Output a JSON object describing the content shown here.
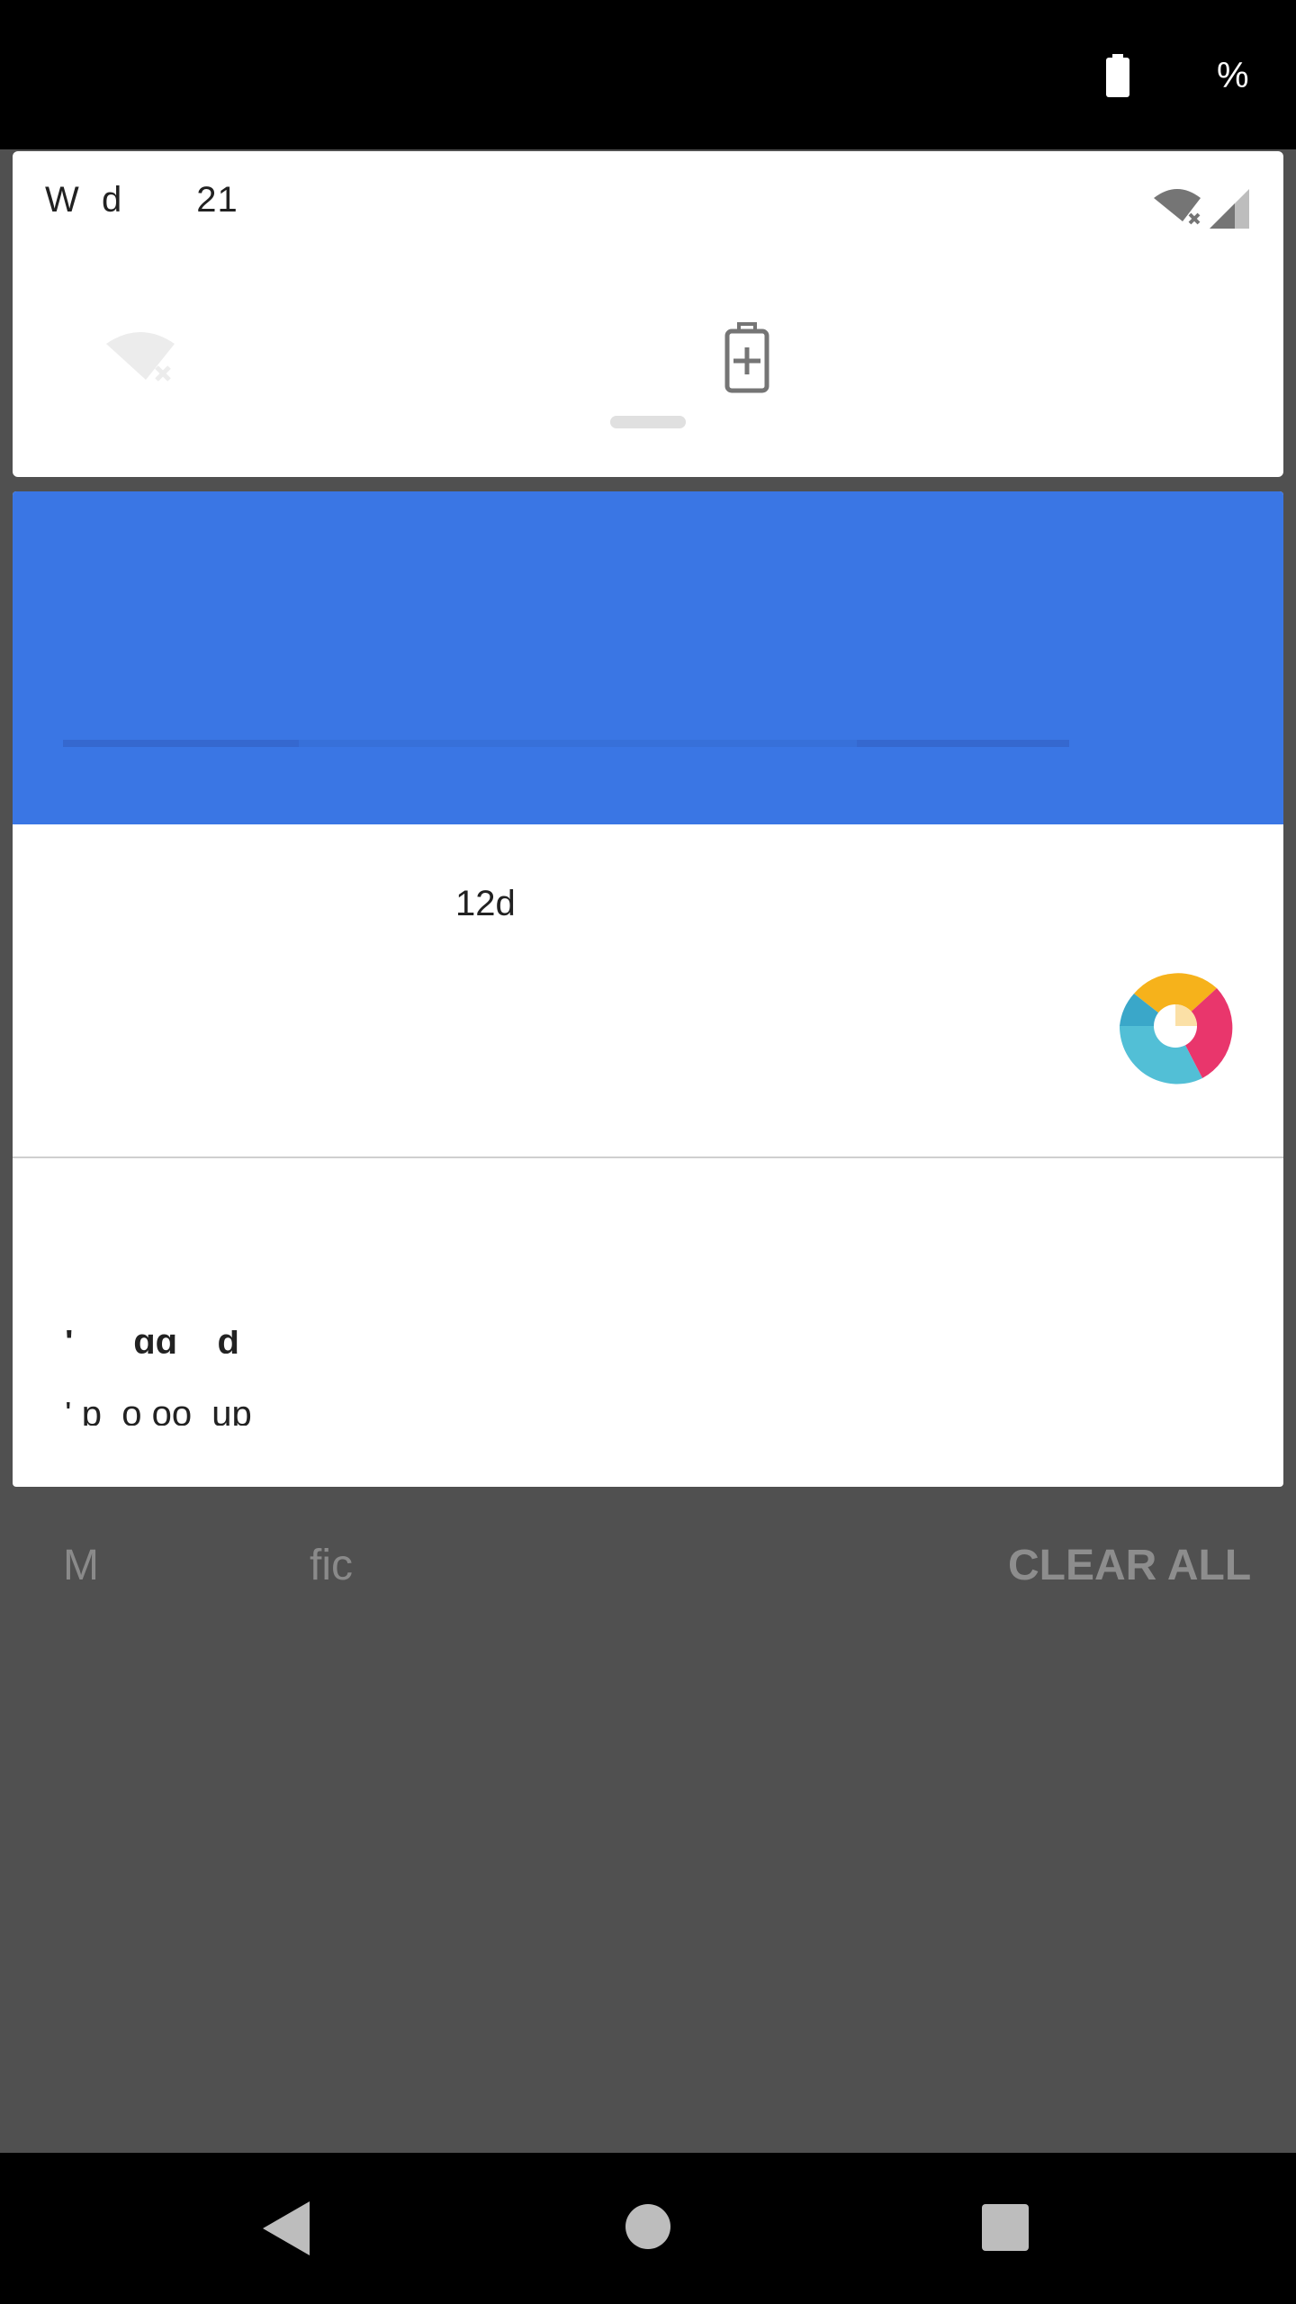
{
  "status_bar": {
    "battery_icon": "battery-full-icon",
    "percent_text": "%"
  },
  "quick_settings": {
    "date_text": "W  d",
    "date_number": "21",
    "icons": [
      "wifi-off-icon",
      "cell-signal-icon",
      "battery-saver-icon"
    ]
  },
  "notification": {
    "banner_color": "#3a76e4",
    "time_text": "12d",
    "logo_icon": "app-logo-icon",
    "line1_text": "'      gg    d",
    "line2_text": "' p  o oo  up"
  },
  "footer": {
    "manage_label": "M",
    "fic_label": "fic",
    "clear_all_label": "CLEAR ALL"
  },
  "nav_bar": {
    "icons": [
      "back-icon",
      "home-icon",
      "recents-icon"
    ]
  }
}
